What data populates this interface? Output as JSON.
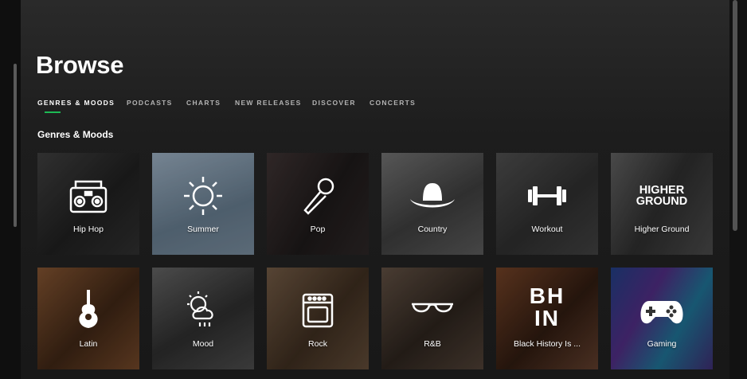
{
  "page": {
    "title": "Browse"
  },
  "tabs": [
    {
      "label": "GENRES & MOODS",
      "active": true
    },
    {
      "label": "PODCASTS",
      "active": false
    },
    {
      "label": "CHARTS",
      "active": false
    },
    {
      "label": "NEW RELEASES",
      "active": false
    },
    {
      "label": "DISCOVER",
      "active": false
    },
    {
      "label": "CONCERTS",
      "active": false
    }
  ],
  "section": {
    "title": "Genres & Moods"
  },
  "tiles": [
    {
      "label": "Hip Hop",
      "icon": "boombox-icon"
    },
    {
      "label": "Summer",
      "icon": "sun-icon"
    },
    {
      "label": "Pop",
      "icon": "microphone-icon"
    },
    {
      "label": "Country",
      "icon": "cowboy-hat-icon"
    },
    {
      "label": "Workout",
      "icon": "dumbbell-icon"
    },
    {
      "label": "Higher Ground",
      "icon": "higher-ground-logo",
      "logo_text": [
        "HIGHER",
        "GROUND"
      ]
    },
    {
      "label": "Latin",
      "icon": "guitar-icon"
    },
    {
      "label": "Mood",
      "icon": "weather-icon"
    },
    {
      "label": "Rock",
      "icon": "amplifier-icon"
    },
    {
      "label": "R&B",
      "icon": "sunglasses-icon"
    },
    {
      "label": "Black History Is ...",
      "icon": "bhin-logo",
      "logo_text": [
        "BH",
        "IN"
      ]
    },
    {
      "label": "Gaming",
      "icon": "gamepad-icon"
    }
  ],
  "colors": {
    "accent": "#1db954",
    "background": "#121212",
    "text_muted": "#b3b3b3"
  }
}
